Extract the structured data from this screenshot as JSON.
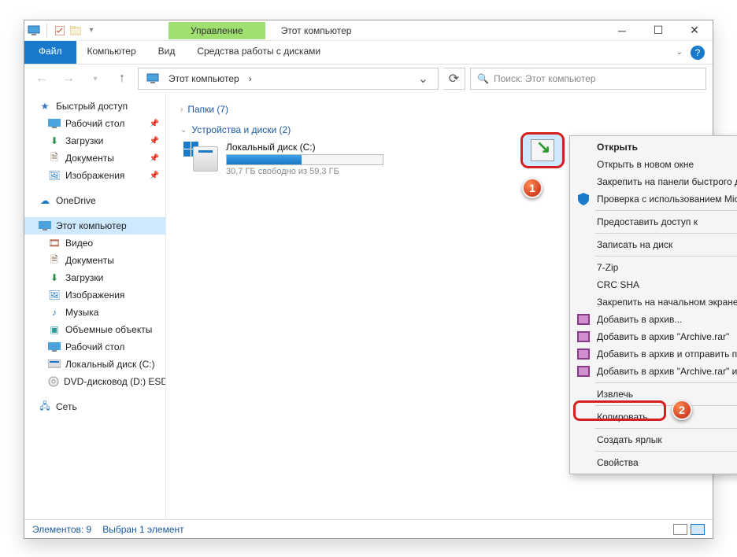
{
  "titlebar": {
    "manage_label": "Управление",
    "title": "Этот компьютер"
  },
  "ribbon": {
    "file": "Файл",
    "home": "Компьютер",
    "view": "Вид",
    "context": "Средства работы с дисками"
  },
  "address": {
    "location": "Этот компьютер",
    "crumb_sep": "›"
  },
  "search": {
    "placeholder": "Поиск: Этот компьютер"
  },
  "sidebar": {
    "quick": "Быстрый доступ",
    "desktop": "Рабочий стол",
    "downloads": "Загрузки",
    "documents": "Документы",
    "pictures": "Изображения",
    "onedrive": "OneDrive",
    "thispc": "Этот компьютер",
    "video": "Видео",
    "documents2": "Документы",
    "downloads2": "Загрузки",
    "pictures2": "Изображения",
    "music": "Музыка",
    "objects3d": "Объемные объекты",
    "desktop2": "Рабочий стол",
    "localdisk": "Локальный диск (C:)",
    "dvd": "DVD-дисковод (D:) ESD-",
    "network": "Сеть"
  },
  "content": {
    "folders_header": "Папки (7)",
    "drives_header": "Устройства и диски (2)",
    "drive_c_name": "Локальный диск (C:)",
    "drive_c_free": "30,7 ГБ свободно из 59,3 ГБ"
  },
  "context_menu": {
    "open": "Открыть",
    "open_new": "Открыть в новом окне",
    "pin_quick": "Закрепить на панели быстрого доступа",
    "defender": "Проверка с использованием Microsoft Defender...",
    "share_access": "Предоставить доступ к",
    "burn": "Записать на диск",
    "sevenzip": "7-Zip",
    "crcsha": "CRC SHA",
    "pin_start": "Закрепить на начальном экране",
    "add_archive": "Добавить в архив...",
    "add_archive_rar": "Добавить в архив \"Archive.rar\"",
    "add_email": "Добавить в архив и отправить по e-mail...",
    "add_rar_email": "Добавить в архив \"Archive.rar\" и отправить по e-mail",
    "extract": "Извлечь",
    "copy": "Копировать",
    "shortcut": "Создать ярлык",
    "properties": "Свойства"
  },
  "markers": {
    "one": "1",
    "two": "2"
  },
  "status": {
    "items": "Элементов: 9",
    "selected": "Выбран 1 элемент"
  }
}
